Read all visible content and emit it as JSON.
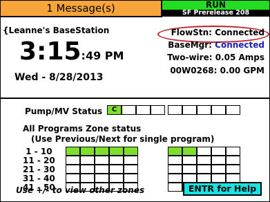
{
  "header": {
    "messages": "1 Message(s)",
    "status": "RUN",
    "release": "SF Prerelease 208"
  },
  "station": {
    "name": "{Leanne's BaseStation",
    "time_main": "3:15",
    "time_seconds": ":49 PM",
    "date": "Wed - 8/28/2013"
  },
  "status_panel": {
    "flowstn": "FlowStn: Connected",
    "basemgr_label": "BaseMgr: ",
    "basemgr_value": "Connected",
    "two_wire": "Two-wire:  0.05 Amps",
    "flow_device": "00W0268: 0.00 GPM"
  },
  "colors": {
    "message_bar": "#f7a43a",
    "run_bar": "#22dd22",
    "active_zone": "#7ddf2a",
    "help_button": "#19e2e2",
    "connected_text": "#1a1ab0",
    "highlight_oval": "#c0202a"
  },
  "pump": {
    "label": "Pump/MV Status",
    "cells": [
      "C",
      "",
      "",
      "",
      "",
      "",
      "",
      "",
      ""
    ],
    "active": [
      true,
      false,
      false,
      false,
      false,
      false,
      false,
      false,
      false
    ]
  },
  "zones": {
    "title": "All Programs Zone status",
    "subtitle": "(Use Previous/Next for single program)",
    "rows": [
      {
        "label": " 1 - 10",
        "active": [
          true,
          true,
          true,
          true,
          true,
          true,
          true,
          false,
          false,
          false
        ]
      },
      {
        "label": "11 - 20",
        "active": [
          false,
          false,
          false,
          false,
          false,
          false,
          false,
          false,
          false,
          false
        ]
      },
      {
        "label": "21 - 30",
        "active": [
          false,
          false,
          false,
          false,
          false,
          false,
          false,
          false,
          false,
          false
        ]
      },
      {
        "label": "31 - 40",
        "active": [
          false,
          false,
          false,
          false,
          false,
          false,
          false,
          false,
          false,
          false
        ]
      },
      {
        "label": "41 - 50",
        "active": [
          false,
          false,
          false,
          false,
          false,
          false,
          false,
          false,
          false,
          false
        ]
      }
    ]
  },
  "footer": {
    "hint": "Use +/- to view other zones",
    "help": "ENTR for Help"
  }
}
